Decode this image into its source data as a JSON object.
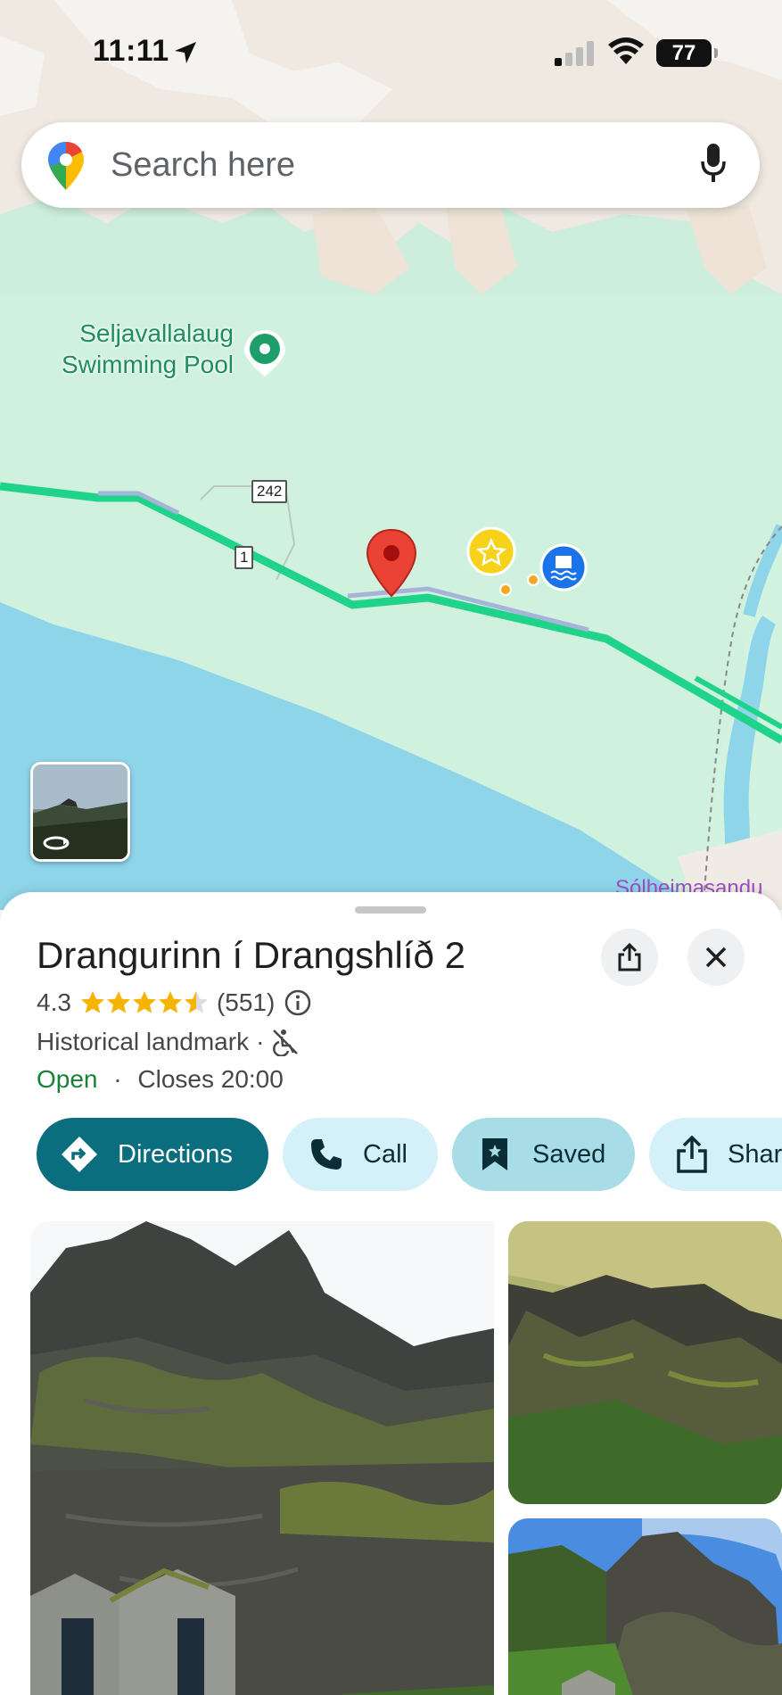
{
  "status_bar": {
    "time": "11:11",
    "battery": "77"
  },
  "search": {
    "placeholder": "Search here"
  },
  "map": {
    "poi_label": "Seljavallalaug\nSwimming Pool",
    "road_242": "242",
    "road_1": "1",
    "partial_place": "Sólheimasandu"
  },
  "place": {
    "title": "Drangurinn í Drangshlíð 2",
    "rating": "4.3",
    "review_count": "(551)",
    "category": "Historical landmark",
    "category_separator": "·",
    "status": "Open",
    "status_separator": "·",
    "closes": "Closes 20:00"
  },
  "actions": {
    "directions": "Directions",
    "call": "Call",
    "saved": "Saved",
    "share": "Share"
  },
  "icons": [
    "location-arrow-icon",
    "signal-icon",
    "wifi-icon",
    "maps-pin-logo",
    "mic-icon",
    "share-icon",
    "close-icon",
    "star-icon",
    "info-icon",
    "no-wheelchair-icon",
    "directions-icon",
    "phone-icon",
    "bookmark-icon",
    "streetview-icon"
  ],
  "colors": {
    "accent": "#0b6e7f",
    "chip_light": "#d4f1f9",
    "open_green": "#188038",
    "star": "#f5b400",
    "pin_red": "#ea4335",
    "route_green": "#1fd48a"
  }
}
